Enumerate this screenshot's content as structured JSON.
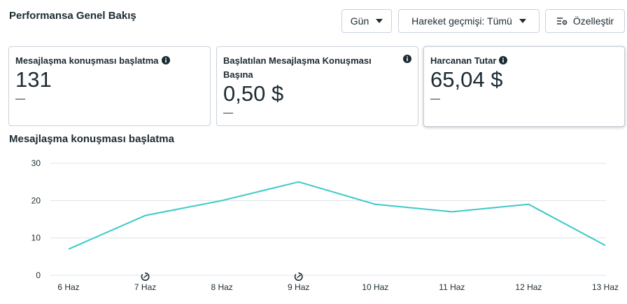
{
  "header": {
    "title": "Performansa Genel Bakış",
    "day_button": "Gün",
    "history_button": "Hareket geçmişi: Tümü",
    "customize_button": "Özelleştir"
  },
  "cards": [
    {
      "label": "Mesajlaşma konuşması başlatma",
      "value": "131",
      "trend": "—",
      "icon": "info-icon"
    },
    {
      "label": "Başlatılan Mesajlaşma Konuşması Başına",
      "value": "0,50 $",
      "trend": "—",
      "icon": "info-icon"
    },
    {
      "label": "Harcanan Tutar",
      "value": "65,04 $",
      "trend": "—",
      "icon": "info-icon"
    }
  ],
  "chart_title": "Mesajlaşma konuşması başlatma",
  "colors": {
    "line": "#3ec9c9",
    "grid": "#dfe3e8",
    "text": "#1c2b33"
  },
  "chart_data": {
    "type": "line",
    "categories": [
      "6 Haz",
      "7 Haz",
      "8 Haz",
      "9 Haz",
      "10 Haz",
      "11 Haz",
      "12 Haz",
      "13 Haz"
    ],
    "series": [
      {
        "values": [
          7,
          16,
          20,
          25,
          19,
          17,
          19,
          8
        ]
      }
    ],
    "yticks": [
      0,
      10,
      20,
      30
    ],
    "ylim": [
      0,
      30
    ],
    "grid": true,
    "markers": [
      {
        "category": "7 Haz",
        "icon": "activity-history-icon"
      },
      {
        "category": "9 Haz",
        "icon": "activity-history-icon"
      }
    ]
  }
}
